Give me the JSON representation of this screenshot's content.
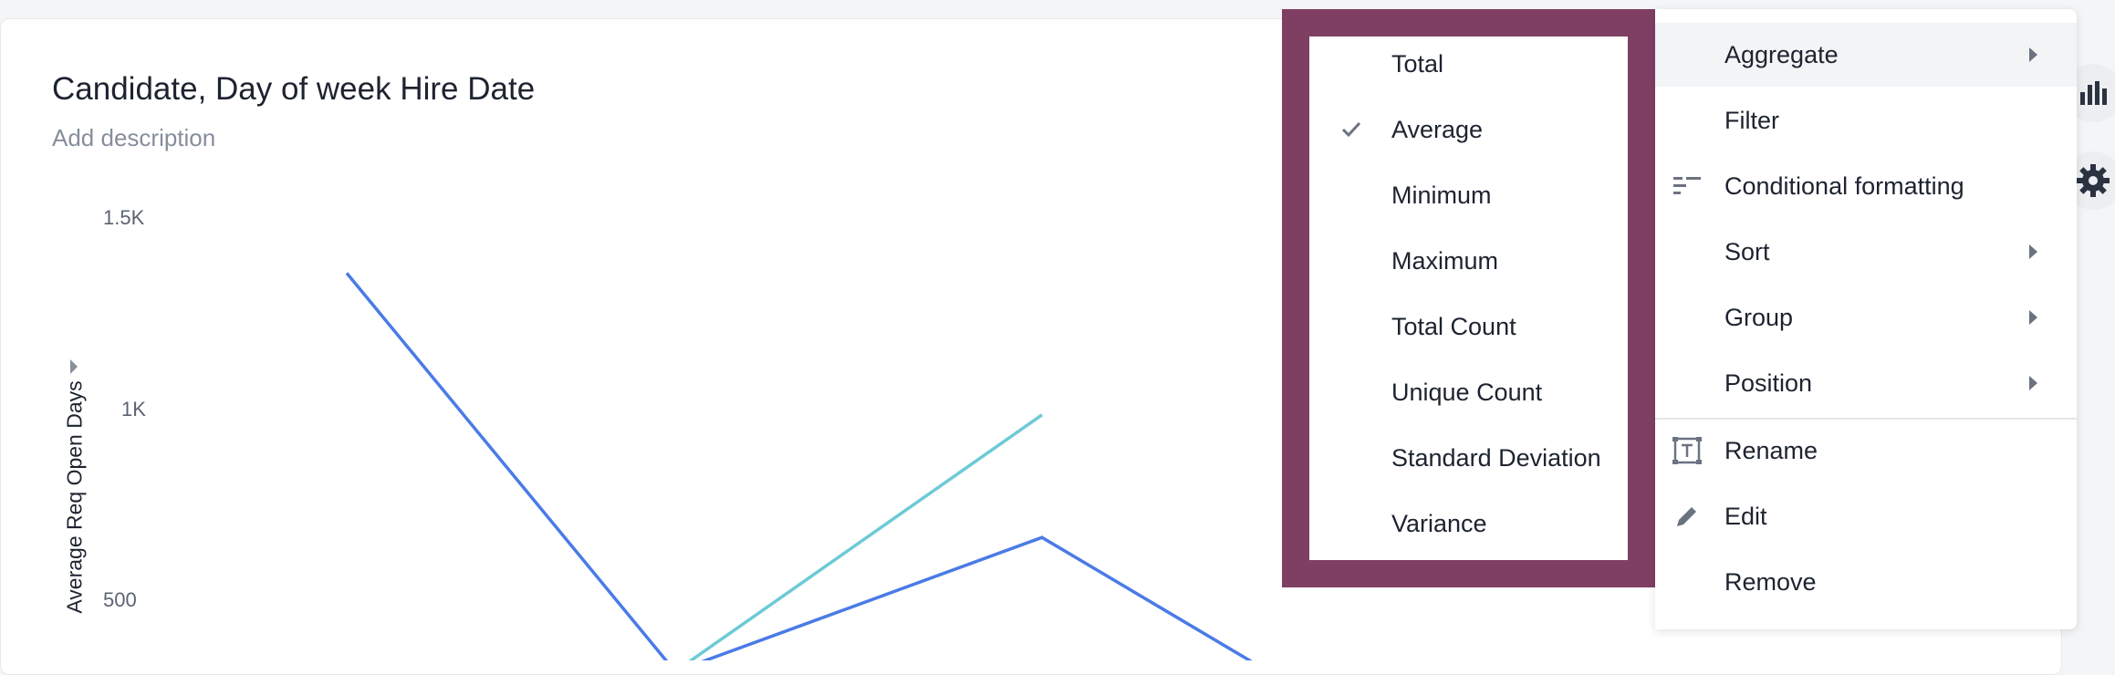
{
  "chart": {
    "title": "Candidate, Day of week Hire Date",
    "description_placeholder": "Add description",
    "y_axis_label": "Average Req Open Days",
    "y_ticks": [
      "1.5K",
      "1K",
      "500"
    ]
  },
  "chart_data": {
    "type": "line",
    "title": "Candidate, Day of week Hire Date",
    "ylabel": "Average Req Open Days",
    "y_tick_labels": [
      "1.5K",
      "1K",
      "500"
    ],
    "series": [
      {
        "color": "#4a7be6",
        "values": [
          1430,
          390,
          740,
          390
        ]
      },
      {
        "color": "#6ccad6",
        "values": [
          null,
          390,
          1060
        ]
      }
    ]
  },
  "aggregate_menu": {
    "items": [
      {
        "label": "Total",
        "checked": false
      },
      {
        "label": "Average",
        "checked": true
      },
      {
        "label": "Minimum",
        "checked": false
      },
      {
        "label": "Maximum",
        "checked": false
      },
      {
        "label": "Total Count",
        "checked": false
      },
      {
        "label": "Unique Count",
        "checked": false
      },
      {
        "label": "Standard Deviation",
        "checked": false
      },
      {
        "label": "Variance",
        "checked": false
      }
    ]
  },
  "context_menu": {
    "items": [
      {
        "label": "Aggregate",
        "icon": "",
        "submenu": true,
        "active": true
      },
      {
        "label": "Filter",
        "icon": "",
        "submenu": false
      },
      {
        "label": "Conditional formatting",
        "icon": "conditional-formatting-icon",
        "submenu": false
      },
      {
        "label": "Sort",
        "icon": "",
        "submenu": true
      },
      {
        "label": "Group",
        "icon": "",
        "submenu": true
      },
      {
        "label": "Position",
        "icon": "",
        "submenu": true
      },
      {
        "label": "Rename",
        "icon": "rename-icon",
        "submenu": false
      },
      {
        "label": "Edit",
        "icon": "pencil-icon",
        "submenu": false
      },
      {
        "label": "Remove",
        "icon": "",
        "submenu": false
      }
    ]
  },
  "side_buttons": [
    {
      "name": "bar-chart-icon"
    },
    {
      "name": "gear-icon"
    }
  ],
  "colors": {
    "highlight_frame": "#7f3f63",
    "line_primary": "#4a7be6",
    "line_secondary": "#6ccad6"
  }
}
